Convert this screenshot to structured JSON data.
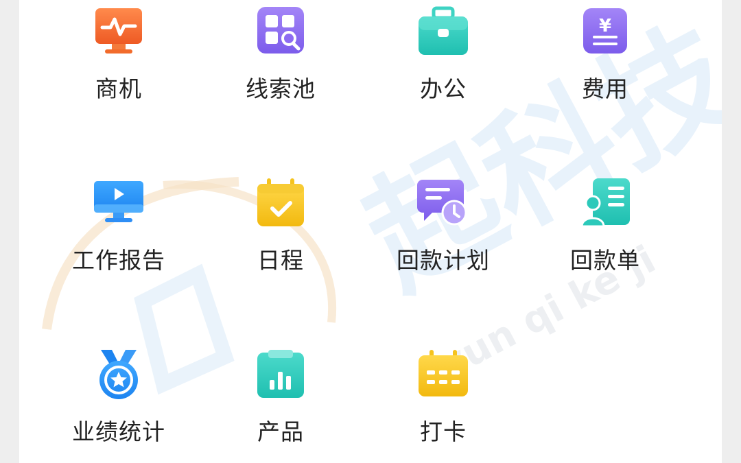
{
  "watermark": {
    "text": "起科技",
    "latin": "yun  qi  ke  ji"
  },
  "apps": [
    {
      "label": "商机",
      "icon": "monitor-pulse-icon"
    },
    {
      "label": "线索池",
      "icon": "grid-search-icon"
    },
    {
      "label": "办公",
      "icon": "briefcase-icon"
    },
    {
      "label": "费用",
      "icon": "yen-document-icon"
    },
    {
      "label": "工作报告",
      "icon": "monitor-play-icon"
    },
    {
      "label": "日程",
      "icon": "calendar-check-icon"
    },
    {
      "label": "回款计划",
      "icon": "message-clock-icon"
    },
    {
      "label": "回款单",
      "icon": "contact-card-icon"
    },
    {
      "label": "业绩统计",
      "icon": "medal-icon"
    },
    {
      "label": "产品",
      "icon": "clipboard-chart-icon"
    },
    {
      "label": "打卡",
      "icon": "calendar-grid-icon"
    }
  ],
  "colors": {
    "orange": "#F26B2B",
    "purple": "#8D6BF2",
    "teal": "#2CC9BA",
    "blue": "#2E8EF5",
    "yellow": "#F5C31E"
  }
}
